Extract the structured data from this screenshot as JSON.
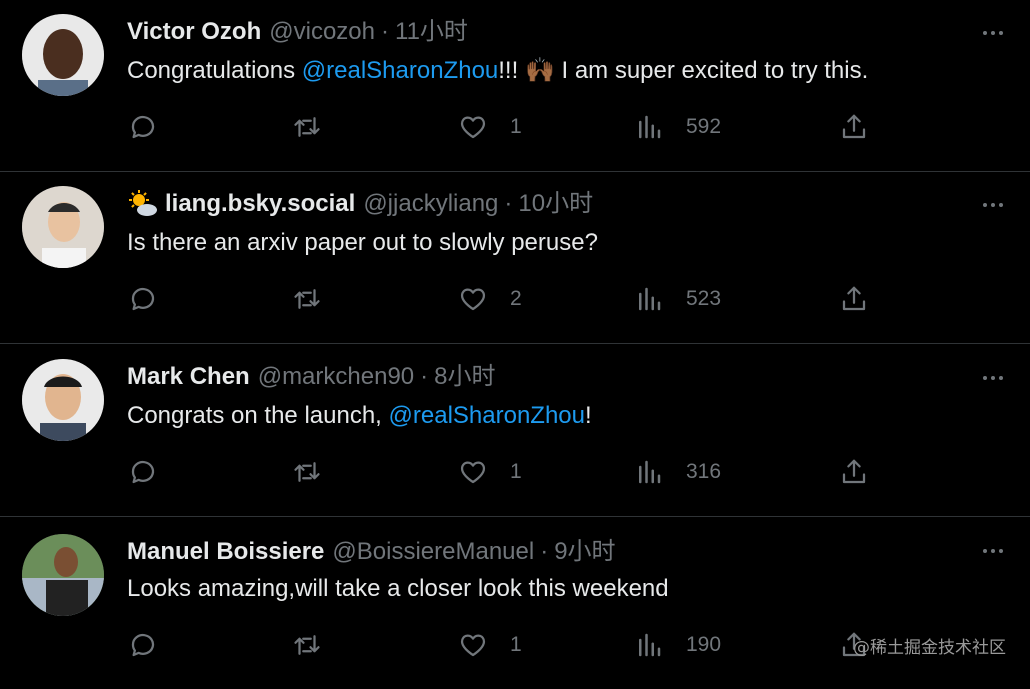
{
  "replies": [
    {
      "name": "Victor Ozoh",
      "handle": "@vicozoh",
      "time": "11小时",
      "text_before": "Congratulations ",
      "mention": "@realSharonZhou",
      "text_after": "!!! 🙌🏾 I am super excited to try this.",
      "likes": "1",
      "views": "592"
    },
    {
      "name": "liang.bsky.social",
      "name_emoji": "🌤",
      "handle": "@jjackyliang",
      "time": "10小时",
      "text_before": "Is there an arxiv paper out to slowly peruse?",
      "likes": "2",
      "views": "523"
    },
    {
      "name": "Mark Chen",
      "handle": "@markchen90",
      "time": "8小时",
      "text_before": "Congrats on the launch, ",
      "mention": "@realSharonZhou",
      "text_after": "!",
      "likes": "1",
      "views": "316"
    },
    {
      "name": "Manuel Boissiere",
      "handle": "@BoissiereManuel",
      "time": "9小时",
      "text_before": "Looks amazing,will take a closer look this weekend",
      "likes": "1",
      "views": "190"
    }
  ],
  "separator": "·",
  "watermark": "@稀土掘金技术社区",
  "colors": {
    "background": "#000000",
    "text": "#e7e9ea",
    "muted": "#71767b",
    "link": "#1d9bf0",
    "border": "#2f3336"
  },
  "icons": [
    "reply-icon",
    "retweet-icon",
    "like-icon",
    "views-icon",
    "share-icon",
    "more-icon"
  ]
}
